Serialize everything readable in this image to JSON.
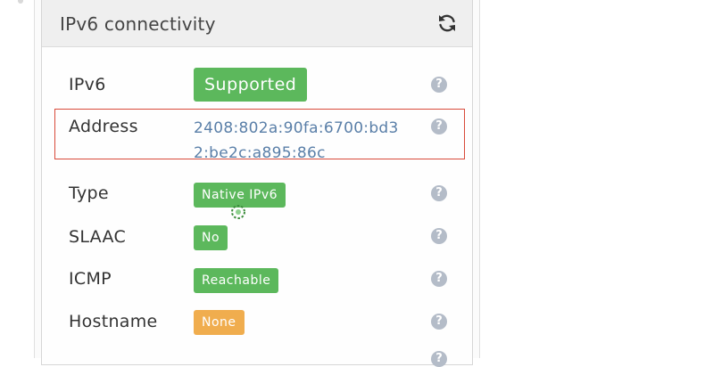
{
  "panel": {
    "title": "IPv6 connectivity",
    "refresh_icon": "refresh-icon"
  },
  "rows": [
    {
      "label": "IPv6",
      "value": "Supported",
      "style": "badge-green"
    },
    {
      "label": "Address",
      "value": "2408:802a:90fa:6700:bd32:be2c:a895:86c",
      "style": "link-text"
    },
    {
      "label": "Type",
      "value": "Native IPv6",
      "style": "badge-green"
    },
    {
      "label": "SLAAC",
      "value": "No",
      "style": "badge-green"
    },
    {
      "label": "ICMP",
      "value": "Reachable",
      "style": "badge-green"
    },
    {
      "label": "Hostname",
      "value": "None",
      "style": "badge-orange"
    }
  ],
  "help_glyph": "?",
  "colors": {
    "success": "#5cb85c",
    "warning": "#f0ad4e",
    "link": "#5a7fa8",
    "highlight": "#d84a3a"
  }
}
